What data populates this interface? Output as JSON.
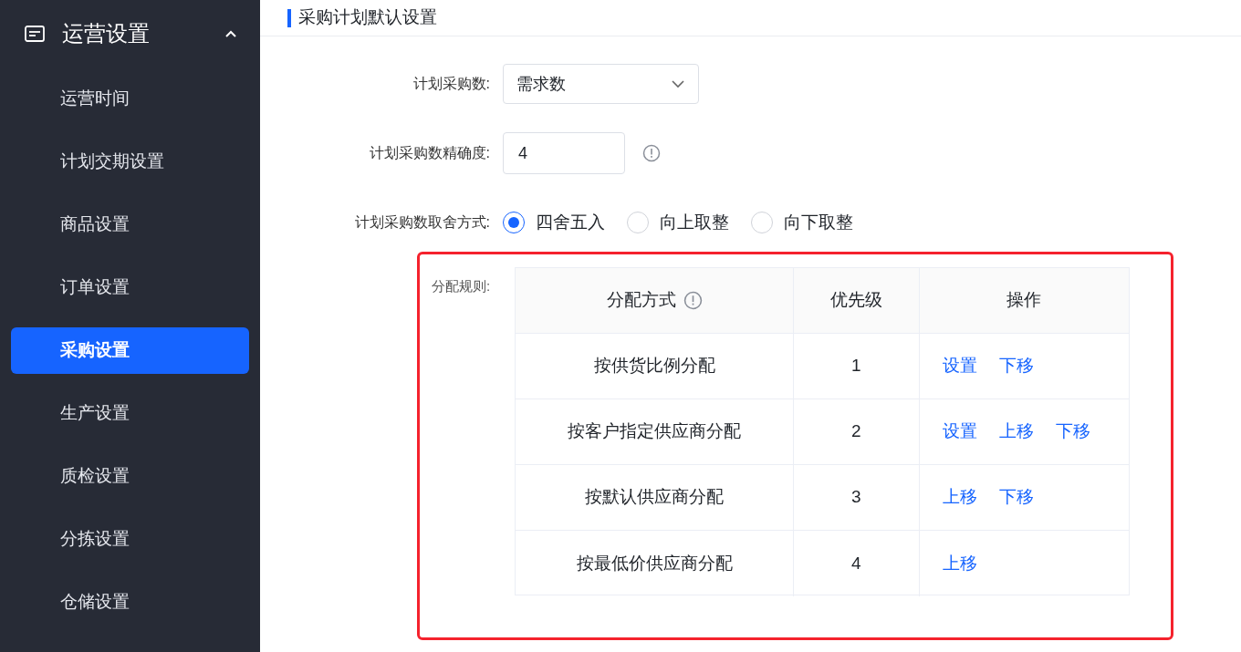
{
  "sidebar": {
    "group": {
      "title": "运营设置",
      "expanded": true
    },
    "items": [
      {
        "label": "运营时间",
        "selected": false
      },
      {
        "label": "计划交期设置",
        "selected": false
      },
      {
        "label": "商品设置",
        "selected": false
      },
      {
        "label": "订单设置",
        "selected": false
      },
      {
        "label": "采购设置",
        "selected": true
      },
      {
        "label": "生产设置",
        "selected": false
      },
      {
        "label": "质检设置",
        "selected": false
      },
      {
        "label": "分拣设置",
        "selected": false
      },
      {
        "label": "仓储设置",
        "selected": false
      }
    ]
  },
  "section": {
    "title": "采购计划默认设置"
  },
  "form": {
    "quantity": {
      "label": "计划采购数:",
      "value": "需求数"
    },
    "precision": {
      "label": "计划采购数精确度:",
      "value": "4"
    },
    "rounding": {
      "label": "计划采购数取舍方式:",
      "options": [
        {
          "label": "四舍五入",
          "selected": true
        },
        {
          "label": "向上取整",
          "selected": false
        },
        {
          "label": "向下取整",
          "selected": false
        }
      ]
    }
  },
  "allocation": {
    "label": "分配规则:",
    "highlighted": true,
    "columns": [
      {
        "label": "分配方式",
        "info": true
      },
      {
        "label": "优先级",
        "info": false
      },
      {
        "label": "操作",
        "info": false
      }
    ],
    "rows": [
      {
        "method": "按供货比例分配",
        "priority": "1",
        "actions": [
          "设置",
          "下移"
        ]
      },
      {
        "method": "按客户指定供应商分配",
        "priority": "2",
        "actions": [
          "设置",
          "上移",
          "下移"
        ]
      },
      {
        "method": "按默认供应商分配",
        "priority": "3",
        "actions": [
          "上移",
          "下移"
        ]
      },
      {
        "method": "按最低价供应商分配",
        "priority": "4",
        "actions": [
          "上移"
        ]
      }
    ]
  }
}
